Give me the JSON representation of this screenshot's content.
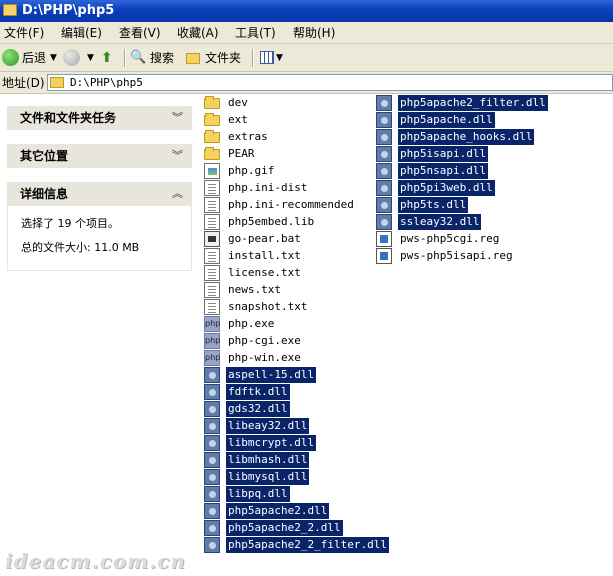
{
  "window": {
    "title": "D:\\PHP\\php5"
  },
  "menu": [
    "文件(F)",
    "编辑(E)",
    "查看(V)",
    "收藏(A)",
    "工具(T)",
    "帮助(H)"
  ],
  "toolbar": {
    "back_label": "后退",
    "search_label": "搜索",
    "folders_label": "文件夹"
  },
  "address": {
    "label": "地址(D)",
    "value": "D:\\PHP\\php5"
  },
  "taskpane": {
    "file_tasks_title": "文件和文件夹任务",
    "other_places_title": "其它位置",
    "details_title": "详细信息",
    "details_selected": "选择了 19 个项目。",
    "details_size": "总的文件大小: 11.0 MB"
  },
  "files_col1": [
    {
      "name": "dev",
      "icon": "folder-icon",
      "selected": false
    },
    {
      "name": "ext",
      "icon": "folder-icon",
      "selected": false
    },
    {
      "name": "extras",
      "icon": "folder-icon",
      "selected": false
    },
    {
      "name": "PEAR",
      "icon": "folder-icon",
      "selected": false
    },
    {
      "name": "php.gif",
      "icon": "image-file-icon",
      "selected": false
    },
    {
      "name": "php.ini-dist",
      "icon": "config-file-icon",
      "selected": false
    },
    {
      "name": "php.ini-recommended",
      "icon": "config-file-icon",
      "selected": false
    },
    {
      "name": "php5embed.lib",
      "icon": "config-file-icon",
      "selected": false
    },
    {
      "name": "go-pear.bat",
      "icon": "batch-file-icon",
      "selected": false
    },
    {
      "name": "install.txt",
      "icon": "text-file-icon",
      "selected": false
    },
    {
      "name": "license.txt",
      "icon": "text-file-icon",
      "selected": false
    },
    {
      "name": "news.txt",
      "icon": "text-file-icon",
      "selected": false
    },
    {
      "name": "snapshot.txt",
      "icon": "text-file-icon",
      "selected": false
    },
    {
      "name": "php.exe",
      "icon": "php-exe-icon",
      "selected": false
    },
    {
      "name": "php-cgi.exe",
      "icon": "php-exe-icon",
      "selected": false
    },
    {
      "name": "php-win.exe",
      "icon": "php-exe-icon",
      "selected": false
    },
    {
      "name": "aspell-15.dll",
      "icon": "dll-file-icon",
      "selected": true
    },
    {
      "name": "fdftk.dll",
      "icon": "dll-file-icon",
      "selected": true
    },
    {
      "name": "gds32.dll",
      "icon": "dll-file-icon",
      "selected": true
    },
    {
      "name": "libeay32.dll",
      "icon": "dll-file-icon",
      "selected": true
    },
    {
      "name": "libmcrypt.dll",
      "icon": "dll-file-icon",
      "selected": true
    },
    {
      "name": "libmhash.dll",
      "icon": "dll-file-icon",
      "selected": true
    },
    {
      "name": "libmysql.dll",
      "icon": "dll-file-icon",
      "selected": true
    },
    {
      "name": "libpq.dll",
      "icon": "dll-file-icon",
      "selected": true
    },
    {
      "name": "php5apache2.dll",
      "icon": "dll-file-icon",
      "selected": true
    },
    {
      "name": "php5apache2_2.dll",
      "icon": "dll-file-icon",
      "selected": true
    },
    {
      "name": "php5apache2_2_filter.dll",
      "icon": "dll-file-icon",
      "selected": true
    }
  ],
  "files_col2": [
    {
      "name": "php5apache2_filter.dll",
      "icon": "dll-file-icon",
      "selected": true
    },
    {
      "name": "php5apache.dll",
      "icon": "dll-file-icon",
      "selected": true
    },
    {
      "name": "php5apache_hooks.dll",
      "icon": "dll-file-icon",
      "selected": true
    },
    {
      "name": "php5isapi.dll",
      "icon": "dll-file-icon",
      "selected": true
    },
    {
      "name": "php5nsapi.dll",
      "icon": "dll-file-icon",
      "selected": true
    },
    {
      "name": "php5pi3web.dll",
      "icon": "dll-file-icon",
      "selected": true
    },
    {
      "name": "php5ts.dll",
      "icon": "dll-file-icon",
      "selected": true
    },
    {
      "name": "ssleay32.dll",
      "icon": "dll-file-icon",
      "selected": true
    },
    {
      "name": "pws-php5cgi.reg",
      "icon": "registry-file-icon",
      "selected": false
    },
    {
      "name": "pws-php5isapi.reg",
      "icon": "registry-file-icon",
      "selected": false
    }
  ],
  "watermark": "ideacm.com.cn",
  "colors": {
    "selection": "#0a246a",
    "titlebar": "#0a3ebc",
    "chrome": "#ece9d8"
  }
}
